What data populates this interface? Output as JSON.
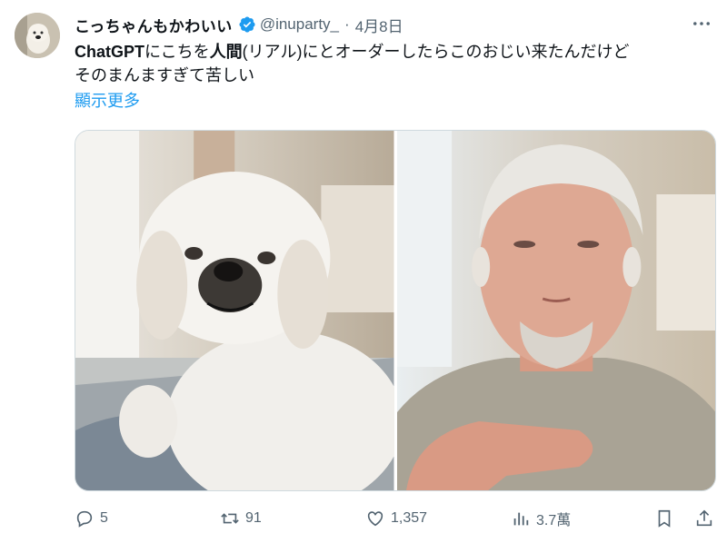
{
  "author": {
    "display_name": "こっちゃんもかわいい",
    "handle": "@inuparty_",
    "separator": "·",
    "date": "4月8日"
  },
  "tweet": {
    "text_bold": "ChatGPT",
    "text_1": "にこちを",
    "text_bold_2": "人間",
    "text_2": "(リアル)にとオーダーしたらこのおじい来たんだけど",
    "text_3": "そのまんますぎて苦しい",
    "show_more": "顯示更多"
  },
  "media": {
    "left_icon": "dog-photo",
    "right_icon": "old-man-photo"
  },
  "actions": {
    "reply_count": "5",
    "retweet_count": "91",
    "like_count": "1,357",
    "views_count": "3.7萬"
  },
  "colors": {
    "accent": "#1d9bf0",
    "muted": "#536471",
    "text": "#0f1419"
  }
}
